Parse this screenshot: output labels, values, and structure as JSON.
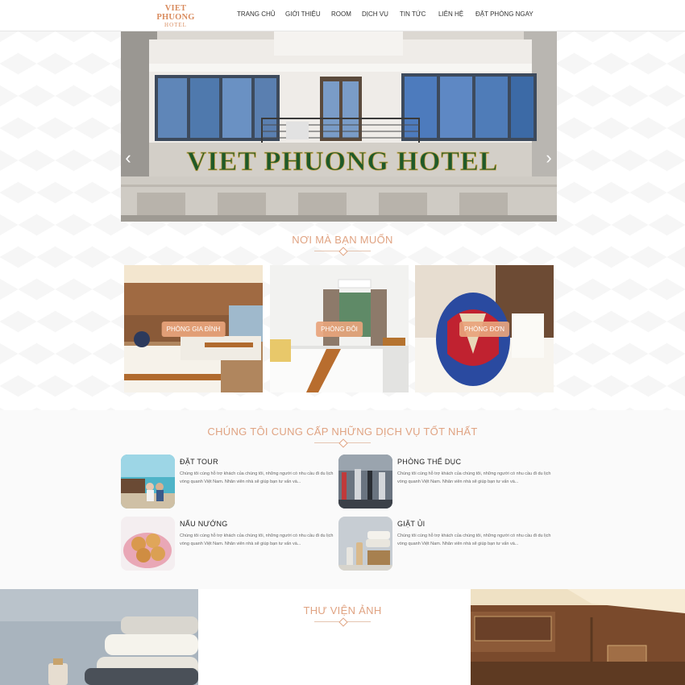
{
  "brand": {
    "line1": "VIET PHUONG",
    "line2": "HOTEL"
  },
  "nav": [
    "TRANG CHỦ",
    "GIỚI THIỆU",
    "ROOM",
    "DỊCH VỤ",
    "TIN TỨC",
    "LIÊN HỆ",
    "ĐẶT PHÒNG NGAY"
  ],
  "hero": {
    "sign_text": "VIET PHUONG HOTEL",
    "prev_arrow": "‹",
    "next_arrow": "›"
  },
  "rooms_section": {
    "title": "NƠI MÀ BẠN MUỐN",
    "rooms": [
      {
        "label": "PHÒNG GIA ĐÌNH"
      },
      {
        "label": "PHÒNG ĐÔI"
      },
      {
        "label": "PHÒNG ĐƠN"
      }
    ]
  },
  "services_section": {
    "title": "CHÚNG TÔI CUNG CẤP NHỮNG DỊCH VỤ TỐT NHẤT",
    "items": [
      {
        "name": "ĐẶT TOUR",
        "desc": "Chúng tôi cùng hỗ trợ khách của chúng tôi, những người có nhu cầu đi du lịch vòng quanh Việt Nam. Nhân viên nhà sẽ giúp bạn tư vấn và..."
      },
      {
        "name": "PHÒNG THỂ DỤC",
        "desc": "Chúng tôi cùng hỗ trợ khách của chúng tôi, những người có nhu cầu đi du lịch vòng quanh Việt Nam. Nhân viên nhà sẽ giúp bạn tư vấn và..."
      },
      {
        "name": "NẤU NƯỚNG",
        "desc": "Chúng tôi cùng hỗ trợ khách của chúng tôi, những người có nhu cầu đi du lịch vòng quanh Việt Nam. Nhân viên nhà sẽ giúp bạn tư vấn và..."
      },
      {
        "name": "GIẶT ỦI",
        "desc": "Chúng tôi cùng hỗ trợ khách của chúng tôi, những người có nhu cầu đi du lịch vòng quanh Việt Nam. Nhân viên nhà sẽ giúp bạn tư vấn và..."
      }
    ]
  },
  "gallery_section": {
    "title": "THƯ VIỆN ẢNH"
  },
  "colors": {
    "accent": "#e0a382",
    "badge": "#e8a47c",
    "sign_green": "#1f5a2a"
  }
}
